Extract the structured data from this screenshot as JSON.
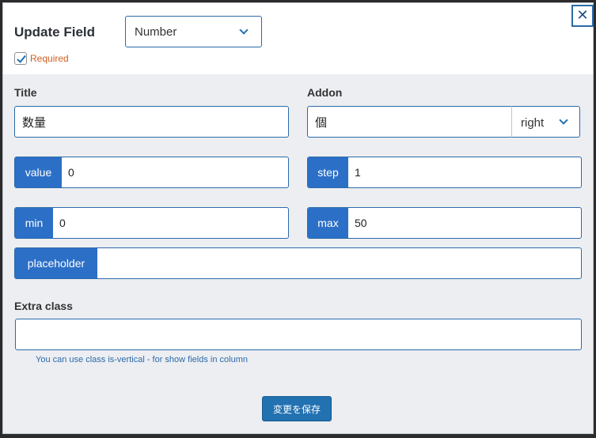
{
  "header": {
    "title": "Update Field",
    "close_label": "✕",
    "type_select": {
      "value": "Number"
    },
    "required": {
      "label": "Required",
      "checked": true
    }
  },
  "fields": {
    "title": {
      "label": "Title",
      "value": "数量"
    },
    "addon": {
      "label": "Addon",
      "value": "個",
      "position": "right"
    },
    "value": {
      "label": "value",
      "value": "0"
    },
    "step": {
      "label": "step",
      "value": "1"
    },
    "min": {
      "label": "min",
      "value": "0"
    },
    "max": {
      "label": "max",
      "value": "50"
    },
    "placeholder": {
      "label": "placeholder",
      "value": ""
    },
    "extra_class": {
      "label": "Extra class",
      "value": "",
      "help": "You can use class is-vertical - for show fields in column"
    }
  },
  "footer": {
    "save_label": "変更を保存"
  },
  "colors": {
    "accent": "#2271b1",
    "tag": "#2c6fc7",
    "required": "#d15e1f"
  }
}
